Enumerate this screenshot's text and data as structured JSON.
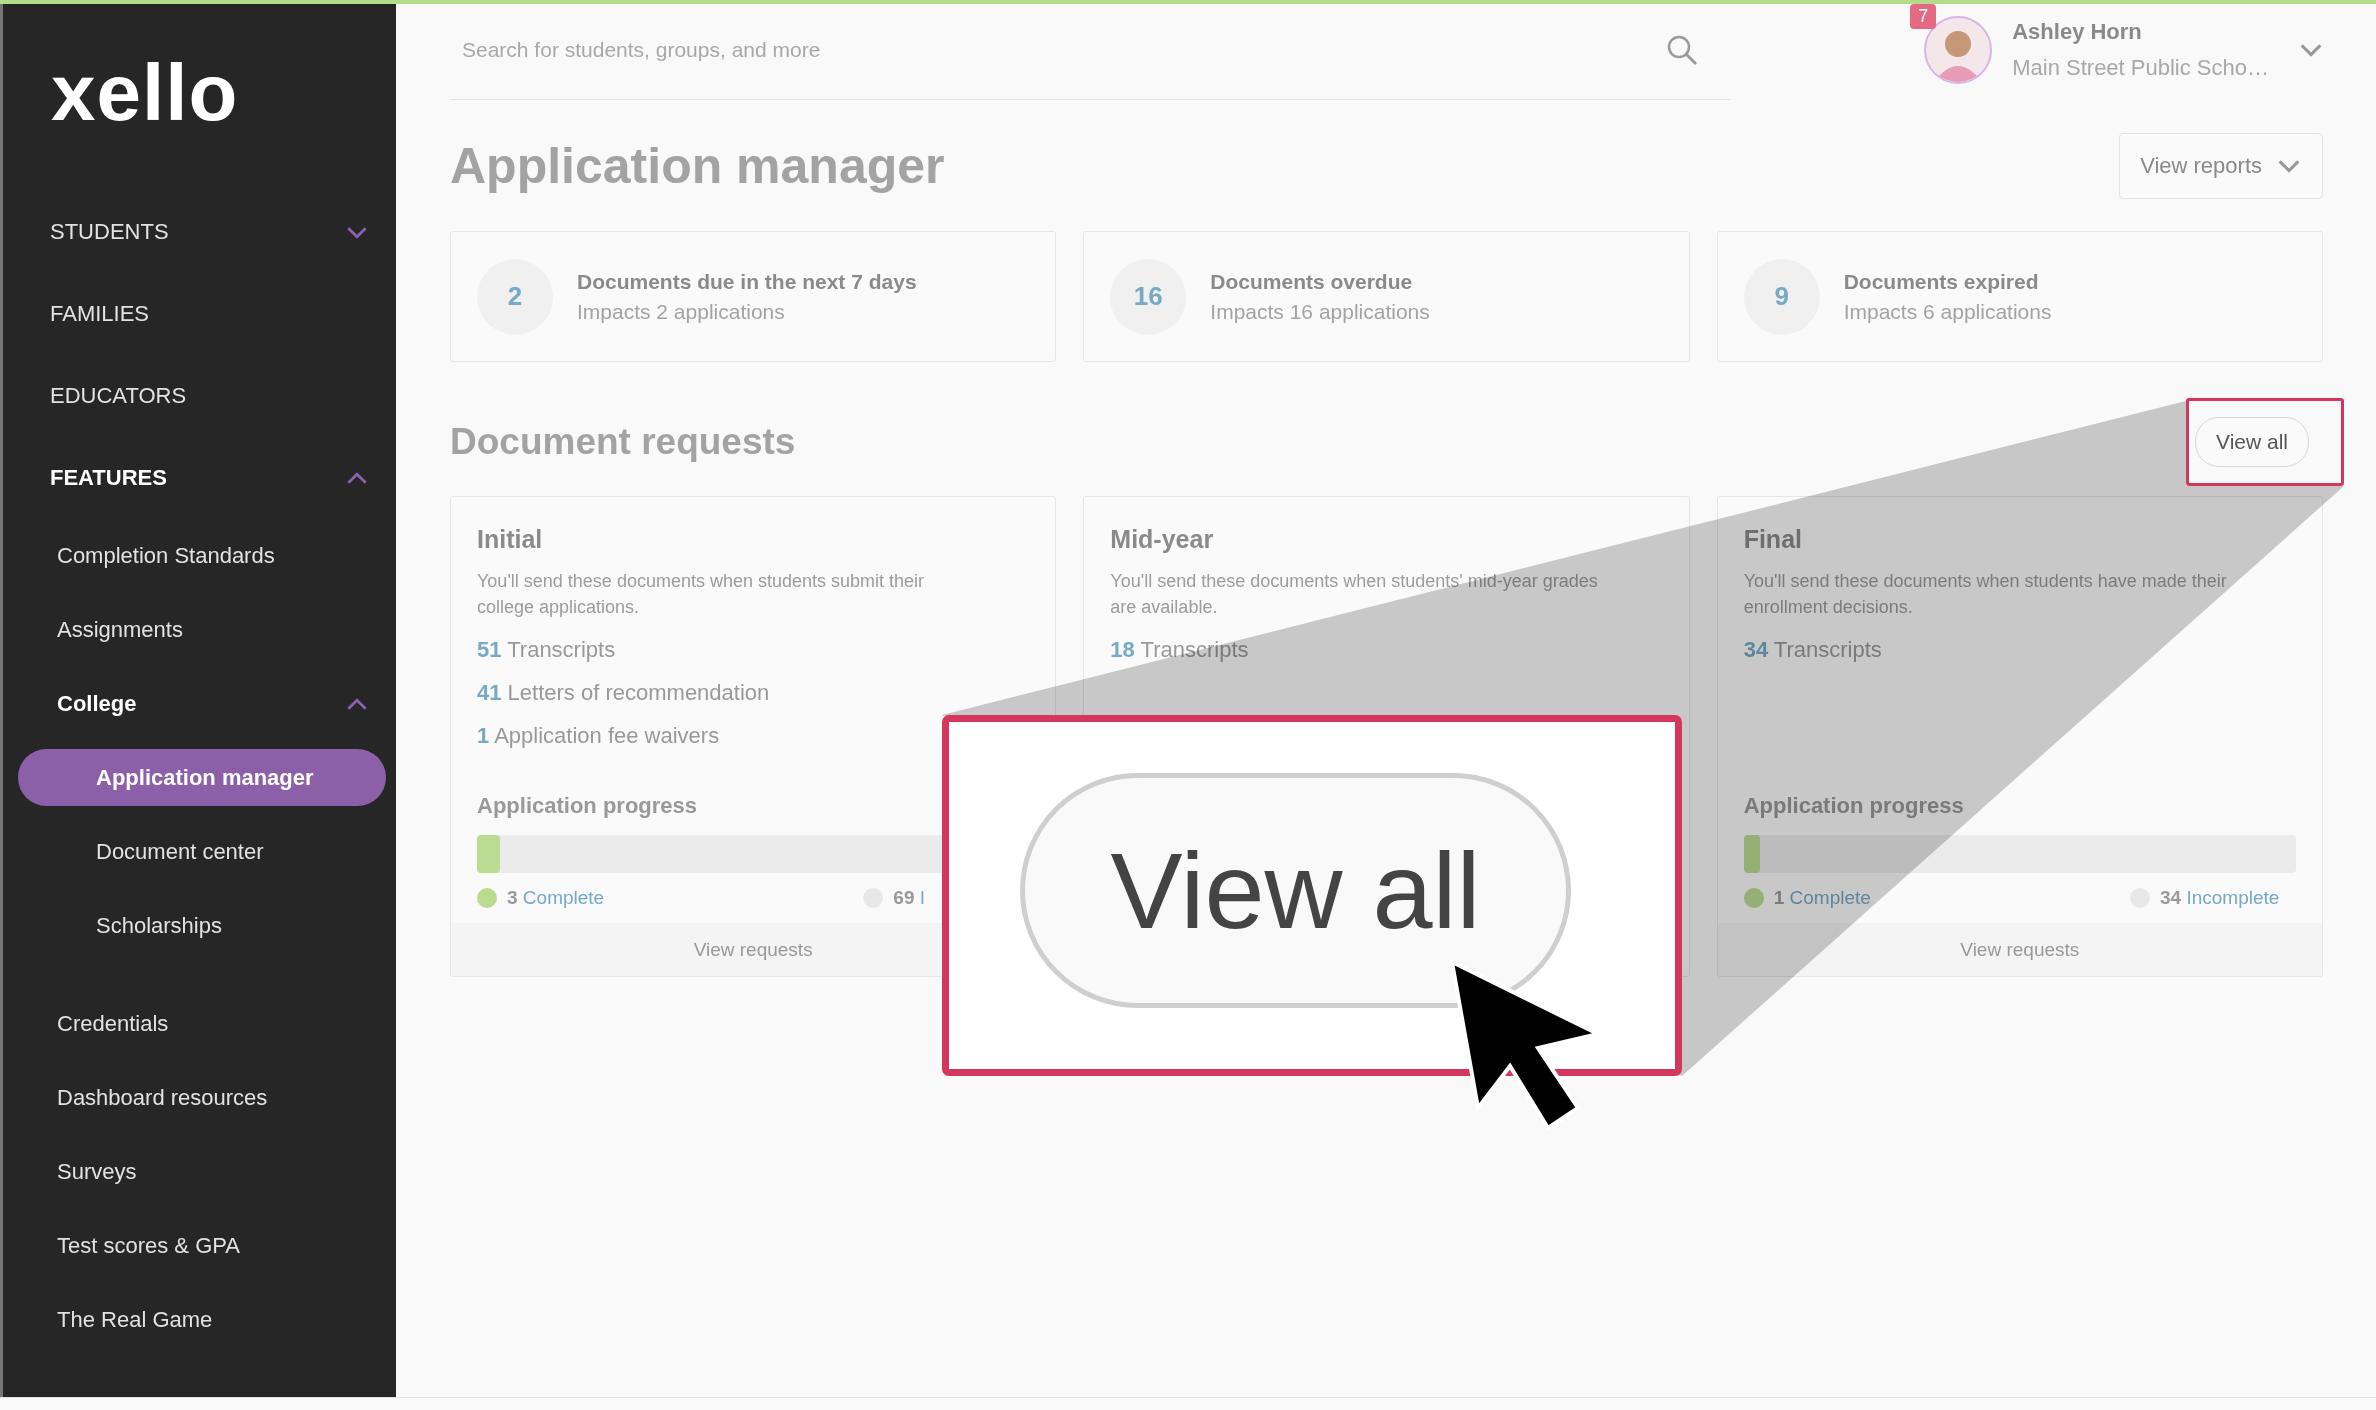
{
  "logo": {
    "text": "xello"
  },
  "sidebar": {
    "items": [
      {
        "label": "STUDENTS",
        "expanded": false,
        "selected": false
      },
      {
        "label": "FAMILIES",
        "selected": false
      },
      {
        "label": "EDUCATORS",
        "selected": false
      },
      {
        "label": "FEATURES",
        "expanded": true,
        "selected": false,
        "children": [
          {
            "label": "Completion Standards",
            "selected": false
          },
          {
            "label": "Assignments",
            "selected": false
          },
          {
            "label": "College",
            "expanded": true,
            "selected": false,
            "children": [
              {
                "label": "Application manager",
                "selected": true
              },
              {
                "label": "Document center",
                "selected": false
              },
              {
                "label": "Scholarships",
                "selected": false
              }
            ]
          },
          {
            "label": "Credentials",
            "selected": false
          },
          {
            "label": "Dashboard resources",
            "selected": false
          },
          {
            "label": "Surveys",
            "selected": false
          },
          {
            "label": "Test scores & GPA",
            "selected": false
          },
          {
            "label": "The Real Game",
            "selected": false
          }
        ]
      }
    ]
  },
  "header": {
    "search": {
      "placeholder": "Search for students, groups, and more"
    },
    "notifications": "7",
    "user": {
      "name": "Ashley Horn",
      "school": "Main Street Public Scho…"
    }
  },
  "page_title": "Application manager",
  "view_reports": "View reports",
  "stats": [
    {
      "value": "2",
      "title": "Documents due in the next 7 days",
      "subtitle": "Impacts 2 applications"
    },
    {
      "value": "16",
      "title": "Documents overdue",
      "subtitle": "Impacts 16 applications"
    },
    {
      "value": "9",
      "title": "Documents expired",
      "subtitle": "Impacts 6 applications"
    }
  ],
  "section_title": "Document requests",
  "view_all": "View all",
  "requests": [
    {
      "title": "Initial",
      "description": "You'll send these documents when students submit their college applications.",
      "documents": [
        {
          "count": "51",
          "label": "Transcripts"
        },
        {
          "count": "41",
          "label": "Letters of recommendation"
        },
        {
          "count": "1",
          "label": "Application fee waivers"
        }
      ],
      "progress": {
        "title": "Application progress",
        "level": 0.042,
        "complete": {
          "count": "3",
          "label": "Complete"
        },
        "incomplete": {
          "count": "69",
          "label": "I"
        }
      },
      "footer": "View requests"
    },
    {
      "title": "Mid-year",
      "description": "You'll send these documents when students' mid-year grades are available.",
      "documents": [
        {
          "count": "18",
          "label": "Transcripts"
        }
      ]
    },
    {
      "title": "Final",
      "description": "You'll send these documents when students have made their enrollment decisions.",
      "documents": [
        {
          "count": "34",
          "label": "Transcripts"
        }
      ],
      "progress": {
        "title": "Application progress",
        "level": 0.029,
        "complete": {
          "count": "1",
          "label": "Complete"
        },
        "incomplete": {
          "count": "34",
          "label": "Incomplete"
        }
      },
      "footer": "View requests"
    }
  ],
  "callout": {
    "label": "View all"
  }
}
